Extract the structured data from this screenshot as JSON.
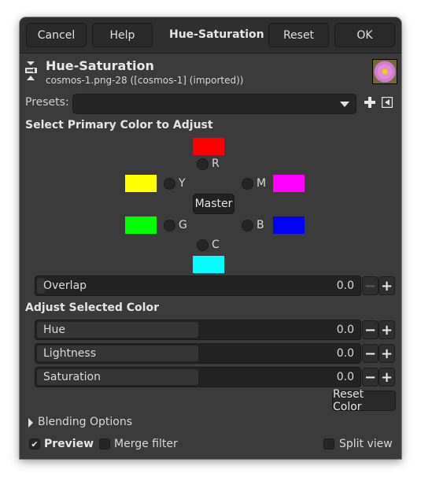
{
  "headerbar": {
    "cancel_label": "Cancel",
    "help_label": "Help",
    "title": "Hue-Saturation",
    "reset_label": "Reset",
    "ok_label": "OK"
  },
  "tool_header": {
    "icon": "hue-saturation-tool-icon",
    "title": "Hue-Saturation",
    "subtitle": "cosmos-1.png-28 ([cosmos-1] (imported))",
    "thumbnail": "cosmos-flower-thumbnail"
  },
  "presets": {
    "label": "Presets:",
    "value": "",
    "add_icon": "plus-icon",
    "menu_icon": "triangle-left-icon"
  },
  "primary_color": {
    "section_title": "Select Primary Color to Adjust",
    "master_label": "Master",
    "colors": [
      {
        "key": "R",
        "label": "R",
        "color": "#ff0000"
      },
      {
        "key": "Y",
        "label": "Y",
        "color": "#ffff00"
      },
      {
        "key": "M",
        "label": "M",
        "color": "#ff00ff"
      },
      {
        "key": "G",
        "label": "G",
        "color": "#00ff00"
      },
      {
        "key": "B",
        "label": "B",
        "color": "#0000ff"
      },
      {
        "key": "C",
        "label": "C",
        "color": "#00ffff"
      }
    ],
    "selected": "Master"
  },
  "overlap": {
    "label": "Overlap",
    "value": "0.0",
    "fraction": 0.0
  },
  "adjust": {
    "section_title": "Adjust Selected Color",
    "sliders": [
      {
        "label": "Hue",
        "value": "0.0",
        "fraction": 0.5
      },
      {
        "label": "Lightness",
        "value": "0.0",
        "fraction": 0.5
      },
      {
        "label": "Saturation",
        "value": "0.0",
        "fraction": 0.5
      }
    ],
    "reset_color_label": "Reset Color"
  },
  "blending_options": {
    "label": "Blending Options",
    "expanded": false
  },
  "footer": {
    "preview": {
      "label": "Preview",
      "checked": true
    },
    "merge_filter": {
      "label": "Merge filter",
      "checked": false
    },
    "split_view": {
      "label": "Split view",
      "checked": false
    }
  }
}
